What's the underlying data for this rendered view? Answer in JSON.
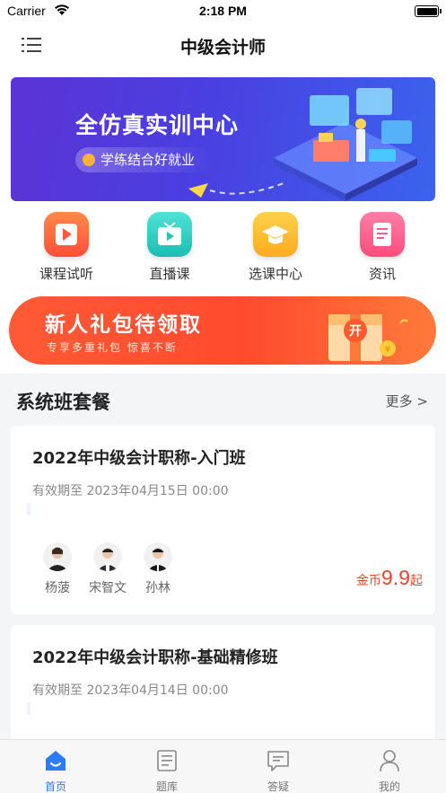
{
  "status_bar": {
    "carrier": "Carrier",
    "time": "2:18 PM"
  },
  "nav": {
    "title": "中级会计师",
    "menu_icon": "list-icon"
  },
  "banner": {
    "headline": "全仿真实训中心",
    "subtitle": "学练结合好就业"
  },
  "quick_menu": [
    {
      "label": "课程试听",
      "icon": "play-icon",
      "color": "#ff6a3d"
    },
    {
      "label": "直播课",
      "icon": "tv-icon",
      "color": "#2ed1c4"
    },
    {
      "label": "选课中心",
      "icon": "graduation-cap-icon",
      "color": "#ffbd2e"
    },
    {
      "label": "资讯",
      "icon": "scroll-icon",
      "color": "#ff5a8c"
    }
  ],
  "promo": {
    "title": "新人礼包待领取",
    "subtitle": "专享多重礼包 惊喜不断",
    "gift_text": "开"
  },
  "section": {
    "title": "系统班套餐",
    "more": "更多 >"
  },
  "courses": [
    {
      "title": "2022年中级会计职称-入门班",
      "valid": "有效期至 2023年04月15日 00:00",
      "teachers": [
        "杨菠",
        "宋智文",
        "孙林"
      ],
      "price_unit": "金币",
      "price": "9.9",
      "price_suffix": "起"
    },
    {
      "title": "2022年中级会计职称-基础精修班",
      "valid": "有效期至 2023年04月14日 00:00"
    }
  ],
  "tabs": [
    {
      "label": "首页",
      "icon": "home-icon",
      "active": true
    },
    {
      "label": "题库",
      "icon": "question-bank-icon",
      "active": false
    },
    {
      "label": "答疑",
      "icon": "chat-icon",
      "active": false
    },
    {
      "label": "我的",
      "icon": "profile-icon",
      "active": false
    }
  ],
  "colors": {
    "accent": "#2b7bf5",
    "price": "#e8452b",
    "promo": "#ff4a2e"
  }
}
